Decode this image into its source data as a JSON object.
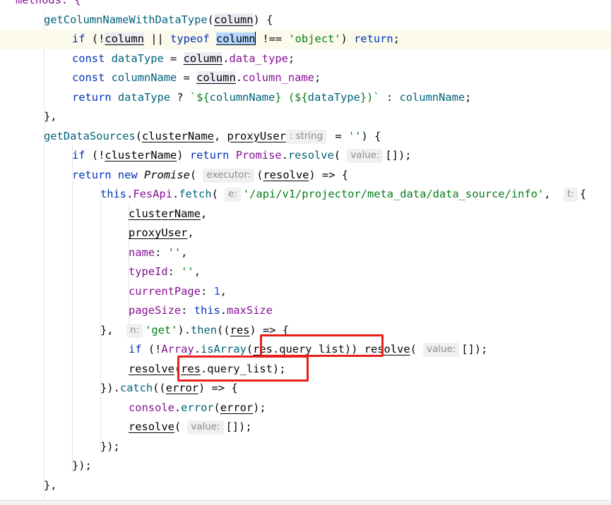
{
  "editor": {
    "lines": [
      {
        "indent": 1,
        "tokens": [
          {
            "t": "methods: {",
            "c": "prop"
          }
        ]
      },
      {
        "indent": 2,
        "tokens": [
          {
            "t": "getColumnNameWithDataType",
            "c": "fn"
          },
          {
            "t": "("
          },
          {
            "t": "column",
            "c": "par usage"
          },
          {
            "t": ") {"
          }
        ]
      },
      {
        "indent": 3,
        "current": true,
        "tokens": [
          {
            "t": "if",
            "c": "kw"
          },
          {
            "t": " (!"
          },
          {
            "t": "column",
            "c": "par usage"
          },
          {
            "t": " || "
          },
          {
            "t": "typeof",
            "c": "kw"
          },
          {
            "t": " "
          },
          {
            "t": "column",
            "c": "par sel"
          },
          {
            "caret": true
          },
          {
            "t": " !== "
          },
          {
            "t": "'object'",
            "c": "str"
          },
          {
            "t": ") "
          },
          {
            "t": "return",
            "c": "kw"
          },
          {
            "t": ";"
          }
        ]
      },
      {
        "indent": 3,
        "tokens": [
          {
            "t": "const",
            "c": "kw"
          },
          {
            "t": " "
          },
          {
            "t": "dataType",
            "c": "fn"
          },
          {
            "t": " = "
          },
          {
            "t": "column",
            "c": "par usage"
          },
          {
            "t": "."
          },
          {
            "t": "data_type",
            "c": "prop"
          },
          {
            "t": ";"
          }
        ]
      },
      {
        "indent": 3,
        "tokens": [
          {
            "t": "const",
            "c": "kw"
          },
          {
            "t": " "
          },
          {
            "t": "columnName",
            "c": "fn"
          },
          {
            "t": " = "
          },
          {
            "t": "column",
            "c": "par usage"
          },
          {
            "t": "."
          },
          {
            "t": "column_name",
            "c": "prop"
          },
          {
            "t": ";"
          }
        ]
      },
      {
        "indent": 3,
        "tokens": [
          {
            "t": "return",
            "c": "kw"
          },
          {
            "t": " "
          },
          {
            "t": "dataType",
            "c": "fn"
          },
          {
            "t": " ? "
          },
          {
            "t": "`${",
            "c": "str"
          },
          {
            "t": "columnName",
            "c": "fn"
          },
          {
            "t": "} (${",
            "c": "str"
          },
          {
            "t": "dataType",
            "c": "fn"
          },
          {
            "t": "})`",
            "c": "str"
          },
          {
            "t": " : "
          },
          {
            "t": "columnName",
            "c": "fn"
          },
          {
            "t": ";"
          }
        ]
      },
      {
        "indent": 2,
        "tokens": [
          {
            "t": "},"
          }
        ]
      },
      {
        "indent": 2,
        "tokens": [
          {
            "t": "getDataSources",
            "c": "fn"
          },
          {
            "t": "("
          },
          {
            "t": "clusterName",
            "c": "par"
          },
          {
            "t": ", "
          },
          {
            "t": "proxyUser",
            "c": "par"
          },
          {
            "hint": ": string"
          },
          {
            "t": " = "
          },
          {
            "t": "''",
            "c": "str"
          },
          {
            "t": ") {"
          }
        ]
      },
      {
        "indent": 3,
        "tokens": [
          {
            "t": "if",
            "c": "kw"
          },
          {
            "t": " (!"
          },
          {
            "t": "clusterName",
            "c": "par"
          },
          {
            "t": ") "
          },
          {
            "t": "return",
            "c": "kw"
          },
          {
            "t": " "
          },
          {
            "t": "Promise",
            "c": "prop"
          },
          {
            "t": "."
          },
          {
            "t": "resolve",
            "c": "meth"
          },
          {
            "t": "( "
          },
          {
            "hint": "value:"
          },
          {
            "t": "[]);"
          }
        ]
      },
      {
        "indent": 3,
        "tokens": [
          {
            "t": "return",
            "c": "kw"
          },
          {
            "t": " "
          },
          {
            "t": "new",
            "c": "kw"
          },
          {
            "t": " "
          },
          {
            "t": "Promise",
            "c": "ital"
          },
          {
            "t": "( "
          },
          {
            "hint": "executor:"
          },
          {
            "t": "("
          },
          {
            "t": "resolve",
            "c": "par"
          },
          {
            "t": ") => {"
          }
        ]
      },
      {
        "indent": 4,
        "tokens": [
          {
            "t": "this",
            "c": "kw"
          },
          {
            "t": "."
          },
          {
            "t": "FesApi",
            "c": "prop"
          },
          {
            "t": "."
          },
          {
            "t": "fetch",
            "c": "meth"
          },
          {
            "t": "( "
          },
          {
            "hint": "e:"
          },
          {
            "t": "'/api/v1/projector/meta_data/data_source/info'",
            "c": "str"
          },
          {
            "t": ",  "
          },
          {
            "hint": "t:"
          },
          {
            "t": "{"
          }
        ]
      },
      {
        "indent": 5,
        "tokens": [
          {
            "t": "clusterName",
            "c": "par"
          },
          {
            "t": ","
          }
        ]
      },
      {
        "indent": 5,
        "tokens": [
          {
            "t": "proxyUser",
            "c": "par"
          },
          {
            "t": ","
          }
        ]
      },
      {
        "indent": 5,
        "tokens": [
          {
            "t": "name",
            "c": "prop"
          },
          {
            "t": ": "
          },
          {
            "t": "''",
            "c": "str"
          },
          {
            "t": ","
          }
        ]
      },
      {
        "indent": 5,
        "tokens": [
          {
            "t": "typeId",
            "c": "prop"
          },
          {
            "t": ": "
          },
          {
            "t": "''",
            "c": "str"
          },
          {
            "t": ","
          }
        ]
      },
      {
        "indent": 5,
        "tokens": [
          {
            "t": "currentPage",
            "c": "prop"
          },
          {
            "t": ": "
          },
          {
            "t": "1",
            "c": "num"
          },
          {
            "t": ","
          }
        ]
      },
      {
        "indent": 5,
        "tokens": [
          {
            "t": "pageSize",
            "c": "prop"
          },
          {
            "t": ": "
          },
          {
            "t": "this",
            "c": "kw"
          },
          {
            "t": "."
          },
          {
            "t": "maxSize",
            "c": "prop"
          }
        ]
      },
      {
        "indent": 4,
        "tokens": [
          {
            "t": "},  "
          },
          {
            "hint": "n:"
          },
          {
            "t": "'get'",
            "c": "str"
          },
          {
            "t": ")."
          },
          {
            "t": "then",
            "c": "meth"
          },
          {
            "t": "(("
          },
          {
            "t": "res",
            "c": "par"
          },
          {
            "t": ") => {"
          }
        ]
      },
      {
        "indent": 5,
        "tokens": [
          {
            "t": "if",
            "c": "kw"
          },
          {
            "t": " (!"
          },
          {
            "t": "Array",
            "c": "prop"
          },
          {
            "t": "."
          },
          {
            "t": "isArray",
            "c": "meth"
          },
          {
            "t": "("
          },
          {
            "t": "res",
            "c": "par"
          },
          {
            "t": "."
          },
          {
            "t": "query_list"
          },
          {
            "t": ")) "
          },
          {
            "t": "resolve",
            "c": "par"
          },
          {
            "t": "( "
          },
          {
            "hint": "value:"
          },
          {
            "t": "[]);"
          }
        ]
      },
      {
        "indent": 5,
        "tokens": [
          {
            "t": "resolve",
            "c": "par"
          },
          {
            "t": "("
          },
          {
            "t": "res",
            "c": "par"
          },
          {
            "t": "."
          },
          {
            "t": "query_list"
          },
          {
            "t": ");"
          }
        ]
      },
      {
        "indent": 4,
        "tokens": [
          {
            "t": "})."
          },
          {
            "t": "catch",
            "c": "meth"
          },
          {
            "t": "(("
          },
          {
            "t": "error",
            "c": "par"
          },
          {
            "t": ") => {"
          }
        ]
      },
      {
        "indent": 5,
        "tokens": [
          {
            "t": "console",
            "c": "prop"
          },
          {
            "t": "."
          },
          {
            "t": "error",
            "c": "meth"
          },
          {
            "t": "("
          },
          {
            "t": "error",
            "c": "par"
          },
          {
            "t": ");"
          }
        ]
      },
      {
        "indent": 5,
        "tokens": [
          {
            "t": "resolve",
            "c": "par"
          },
          {
            "t": "( "
          },
          {
            "hint": "value:"
          },
          {
            "t": "[]);"
          }
        ]
      },
      {
        "indent": 4,
        "tokens": [
          {
            "t": "});"
          }
        ]
      },
      {
        "indent": 3,
        "tokens": [
          {
            "t": "});"
          }
        ]
      },
      {
        "indent": 2,
        "tokens": [
          {
            "t": "},"
          }
        ]
      }
    ]
  },
  "colors": {
    "highlight_box": "#e8201a",
    "selection": "#b3d7ff",
    "current_line": "#fcfaed"
  }
}
